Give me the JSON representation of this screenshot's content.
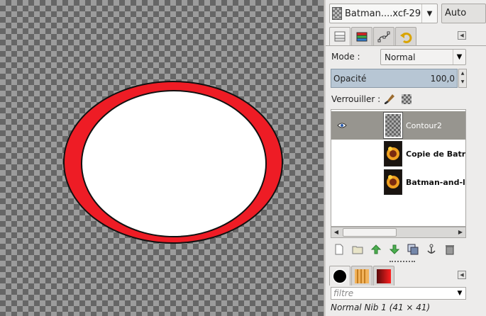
{
  "image_selector": {
    "name": "Batman....xcf-29",
    "auto_label": "Auto"
  },
  "layers_dock": {
    "tabs": [
      "layers-icon",
      "channels-icon",
      "paths-icon",
      "undo-history-icon"
    ],
    "mode": {
      "label": "Mode :",
      "value": "Normal"
    },
    "opacity": {
      "label": "Opacité",
      "value": "100,0"
    },
    "lock": {
      "label": "Verrouiller :"
    },
    "layers": [
      {
        "name": "Contour2",
        "visible": true,
        "selected": true,
        "thumb": "alpha"
      },
      {
        "name": "Copie de Batr",
        "visible": false,
        "selected": false,
        "thumb": "image"
      },
      {
        "name": "Batman-and-l",
        "visible": false,
        "selected": false,
        "thumb": "image"
      }
    ],
    "toolbar": [
      "new-layer-icon",
      "layer-group-icon",
      "raise-layer-icon",
      "lower-layer-icon",
      "duplicate-layer-icon",
      "anchor-layer-icon",
      "delete-layer-icon"
    ]
  },
  "brushes_dock": {
    "tabs": [
      "brushes-icon",
      "patterns-icon",
      "gradients-icon"
    ],
    "filter": {
      "placeholder": "filtre"
    },
    "brush_name": "Normal Nib 1 (41 × 41)"
  },
  "canvas": {
    "shape": "ellipse",
    "outer_color": "#ee1c25",
    "inner_color": "#ffffff",
    "stroke_color": "#111111"
  }
}
